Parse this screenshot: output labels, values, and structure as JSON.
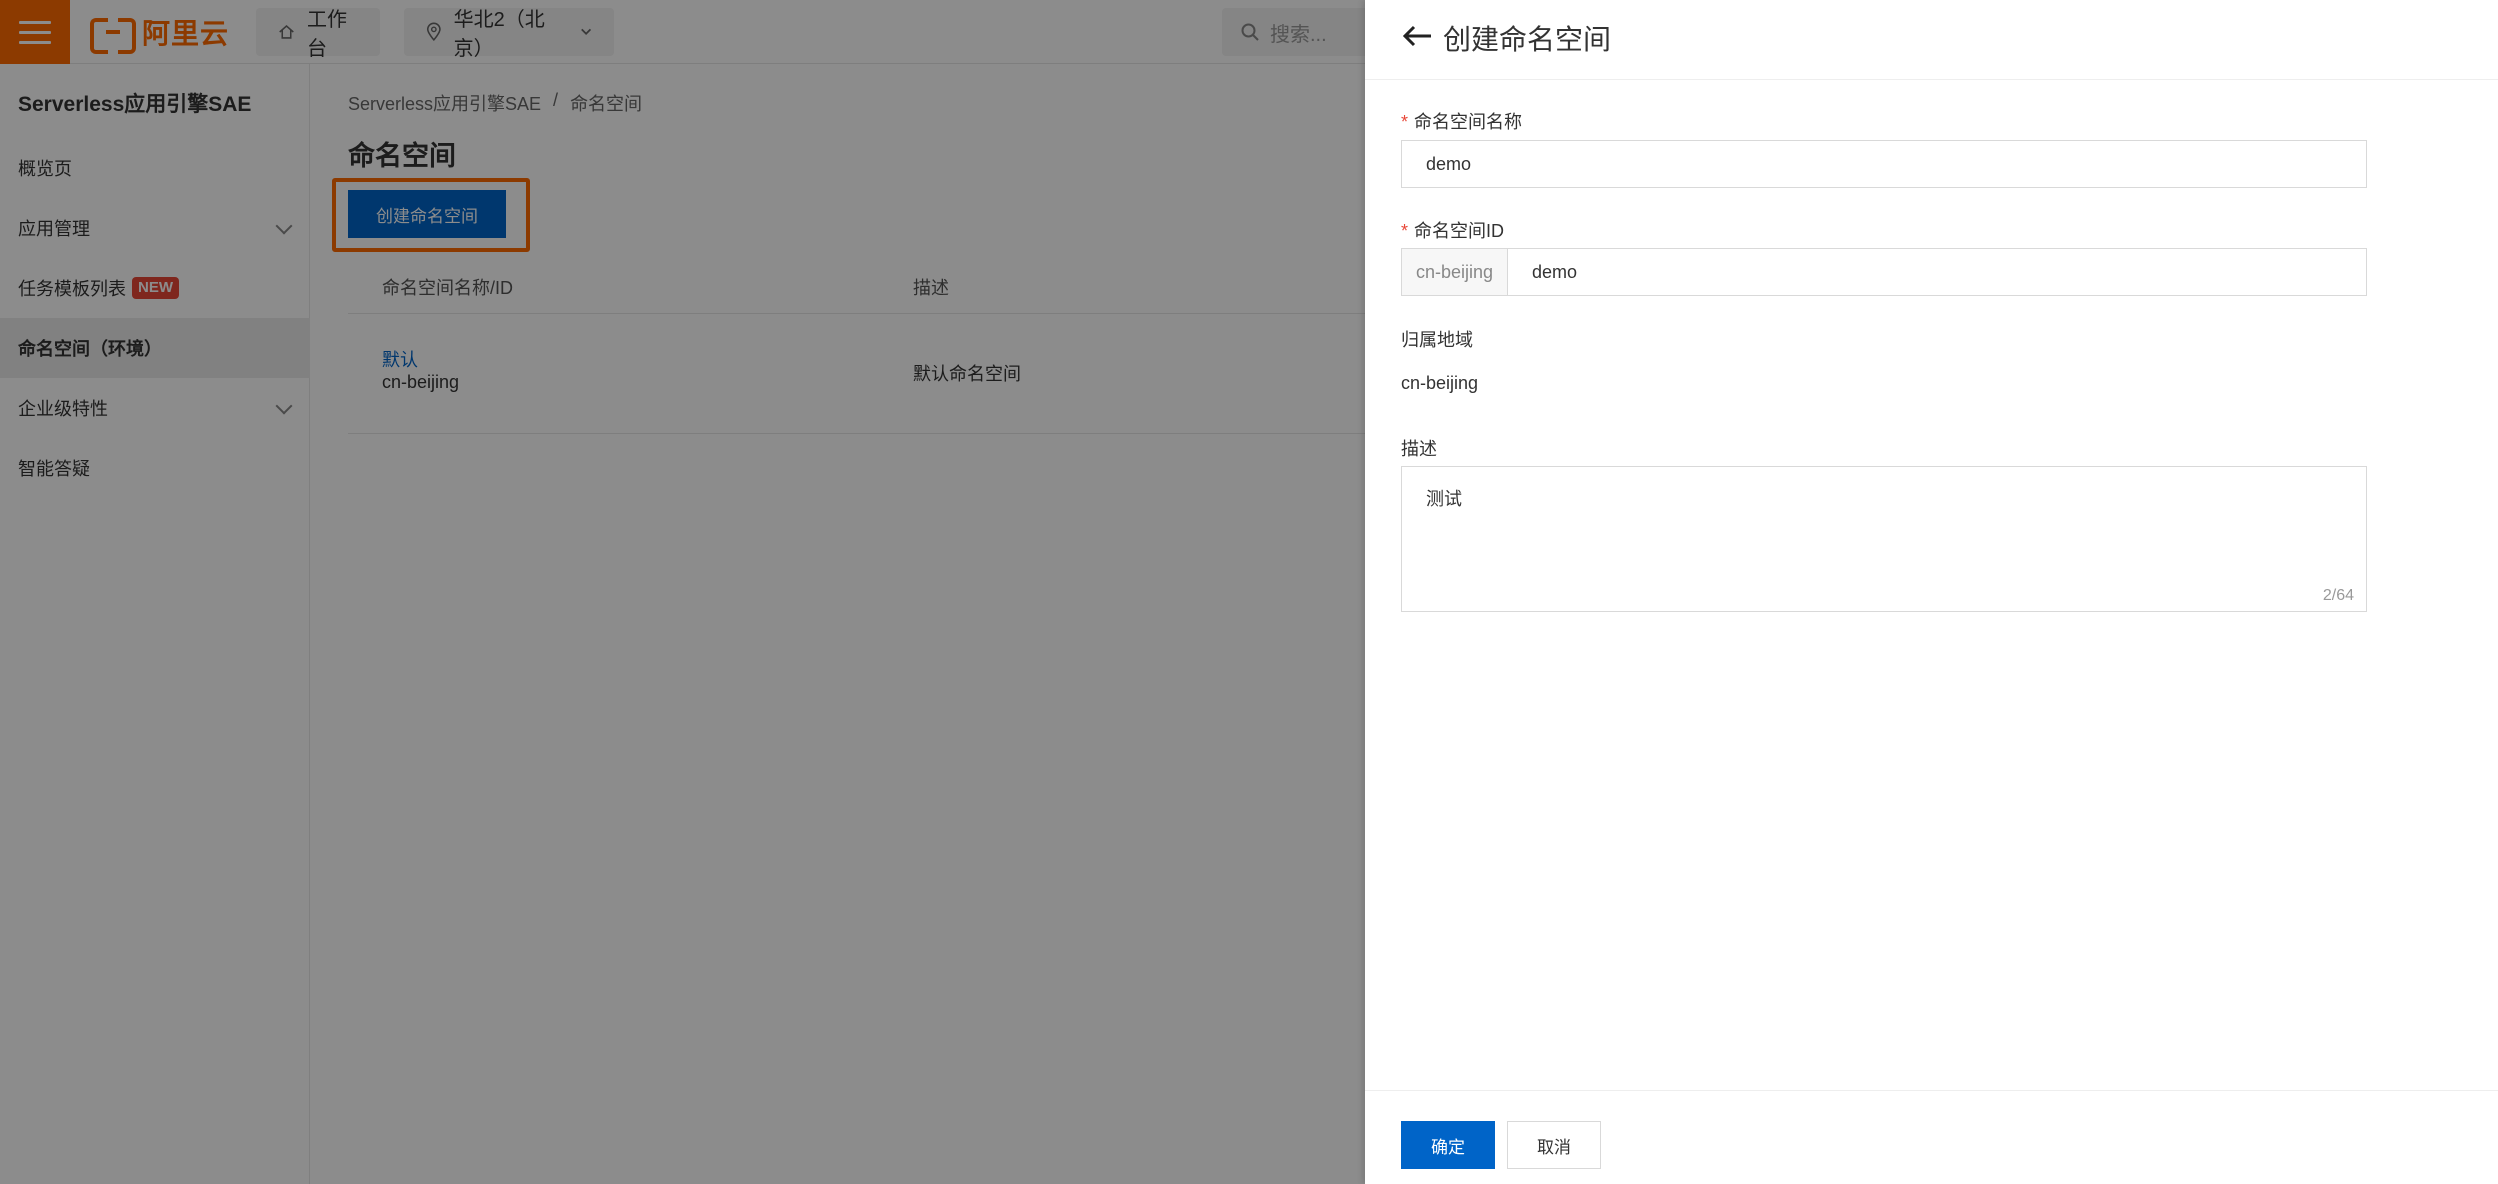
{
  "topbar": {
    "logo_text": "阿里云",
    "home_label": "工作台",
    "region_label": "华北2（北京）",
    "search_placeholder": "搜索..."
  },
  "sidebar": {
    "title": "Serverless应用引擎SAE",
    "items": [
      {
        "label": "概览页"
      },
      {
        "label": "应用管理"
      },
      {
        "label": "任务模板列表",
        "badge": "NEW"
      },
      {
        "label": "命名空间（环境）"
      },
      {
        "label": "企业级特性"
      },
      {
        "label": "智能答疑"
      }
    ]
  },
  "main": {
    "breadcrumb": [
      "Serverless应用引擎SAE",
      "/",
      "命名空间"
    ],
    "page_title": "命名空间",
    "create_button": "创建命名空间",
    "table": {
      "columns": [
        "命名空间名称/ID",
        "描述"
      ],
      "rows": [
        {
          "name": "默认",
          "id": "cn-beijing",
          "description": "默认命名空间"
        }
      ]
    }
  },
  "drawer": {
    "title": "创建命名空间",
    "required_mark": "*",
    "name_label": "命名空间名称",
    "name_value": "demo",
    "id_label": "命名空间ID",
    "id_prefix": "cn-beijing",
    "id_value": "demo",
    "region_label": "归属地域",
    "region_value": "cn-beijing",
    "desc_label": "描述",
    "desc_value": "测试",
    "desc_count": "2/64",
    "ok_button": "确定",
    "cancel_button": "取消"
  },
  "colors": {
    "brand_orange": "#ff6a00",
    "primary_blue": "#0064c8",
    "required_red": "#e84738"
  }
}
